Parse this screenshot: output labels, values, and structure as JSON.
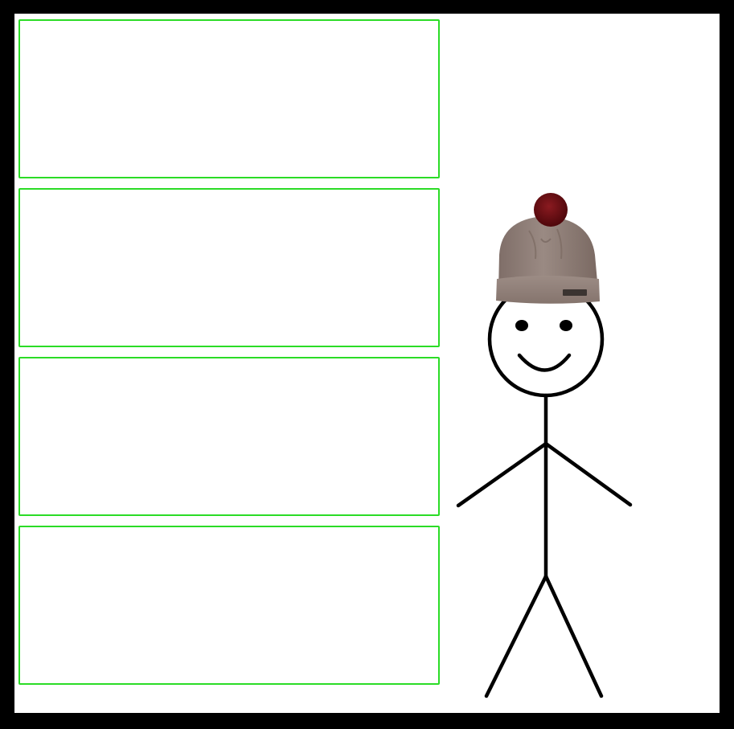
{
  "frame": {
    "border_color": "#000000",
    "background": "#ffffff"
  },
  "panels": [
    {
      "label": ""
    },
    {
      "label": ""
    },
    {
      "label": ""
    },
    {
      "label": ""
    }
  ],
  "panel_border_color": "#2bdc26",
  "character": {
    "icon": "stick-figure-icon",
    "hat": {
      "icon": "beanie-hat-icon",
      "body_color": "#8d7b74",
      "pompom_color": "#6a0f14"
    },
    "expression": "smile"
  }
}
